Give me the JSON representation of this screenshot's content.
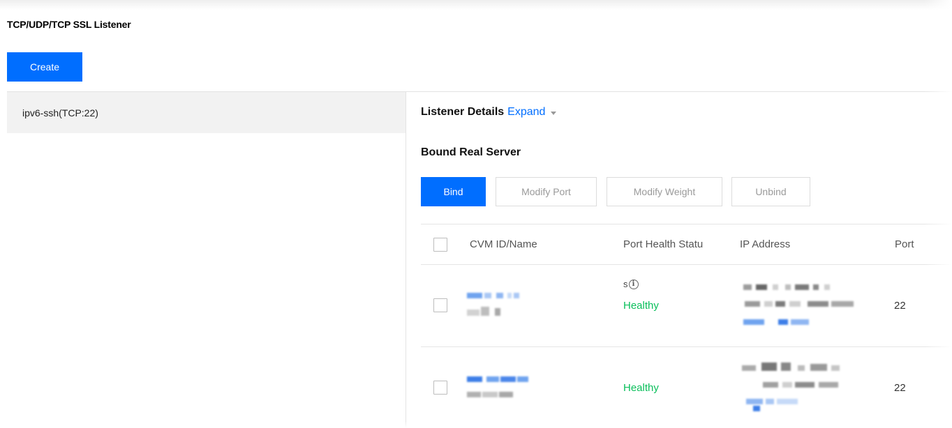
{
  "page": {
    "title": "TCP/UDP/TCP SSL Listener"
  },
  "toolbar": {
    "create_label": "Create"
  },
  "listeners": [
    {
      "label": "ipv6-ssh(TCP:22)"
    }
  ],
  "details": {
    "title": "Listener Details",
    "expand_label": "Expand"
  },
  "bound": {
    "title": "Bound Real Server",
    "buttons": {
      "bind": "Bind",
      "modify_port": "Modify Port",
      "modify_weight": "Modify Weight",
      "unbind": "Unbind"
    }
  },
  "table": {
    "columns": [
      "CVM ID/Name",
      "Port Health Statu",
      "IP Address",
      "Port"
    ],
    "status_note": "s",
    "rows": [
      {
        "health": "Healthy",
        "port": "22"
      },
      {
        "health": "Healthy",
        "port": "22"
      }
    ]
  },
  "icons": {
    "info": "info-icon",
    "caret": "caret-down-icon"
  },
  "colors": {
    "accent": "#006eff",
    "healthy": "#0abf5b",
    "selected_bg": "#f2f2f2"
  }
}
